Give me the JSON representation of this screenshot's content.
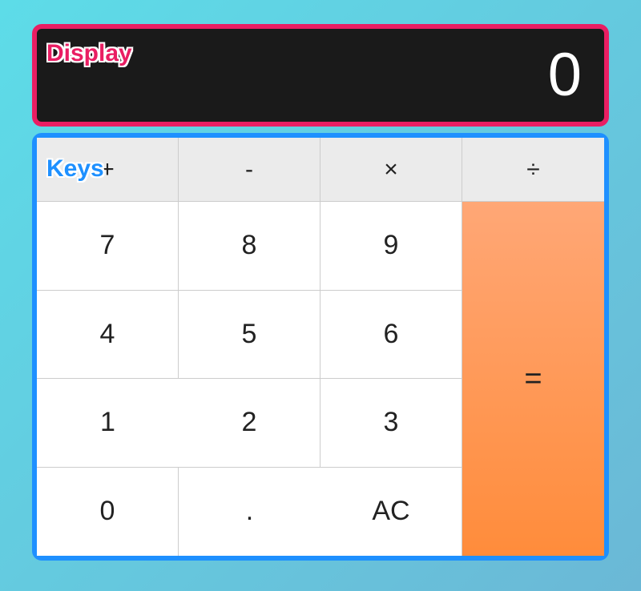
{
  "display": {
    "label": "Display",
    "value": "0"
  },
  "keys": {
    "label": "Keys",
    "ops": {
      "add": "+",
      "subtract": "-",
      "multiply": "×",
      "divide": "÷"
    },
    "digits": {
      "d7": "7",
      "d8": "8",
      "d9": "9",
      "d4": "4",
      "d5": "5",
      "d6": "6",
      "d1": "1",
      "d2": "2",
      "d3": "3",
      "d0": "0"
    },
    "decimal": ".",
    "clear": "AC",
    "equals": "="
  }
}
